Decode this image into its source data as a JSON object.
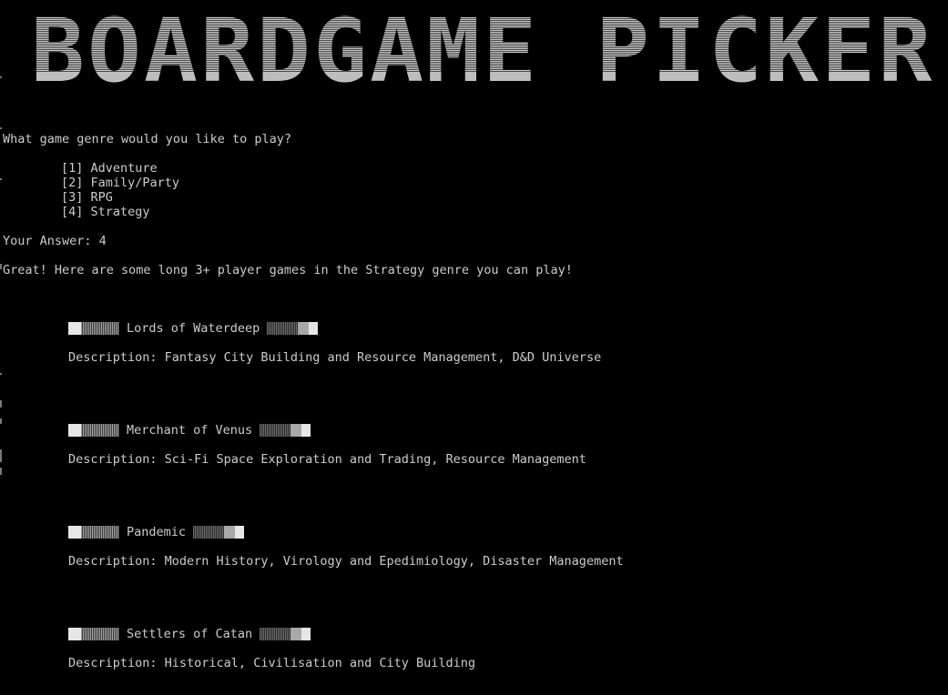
{
  "banner": {
    "text": "BOARDGAME PICKER"
  },
  "prompt": {
    "question": "What game genre would you like to play?",
    "options": [
      "[1] Adventure",
      "[2] Family/Party",
      "[3] RPG",
      "[4] Strategy"
    ],
    "answer_label": "Your Answer: 4"
  },
  "result": {
    "intro": "Great! Here are some long 3+ player games in the Strategy genre you can play!",
    "games": [
      {
        "title": "Lords of Waterdeep",
        "description": "Description: Fantasy City Building and Resource Management, D&D Universe"
      },
      {
        "title": "Merchant of Venus",
        "description": "Description: Sci-Fi Space Exploration and Trading, Resource Management"
      },
      {
        "title": "Pandemic",
        "description": "Description: Modern History, Virology and Epedimiology, Disaster Management"
      },
      {
        "title": "Settlers of Catan",
        "description": "Description: Historical, Civilisation and City Building"
      }
    ]
  },
  "colors": {
    "background": "#000000",
    "text": "#cccccc"
  }
}
